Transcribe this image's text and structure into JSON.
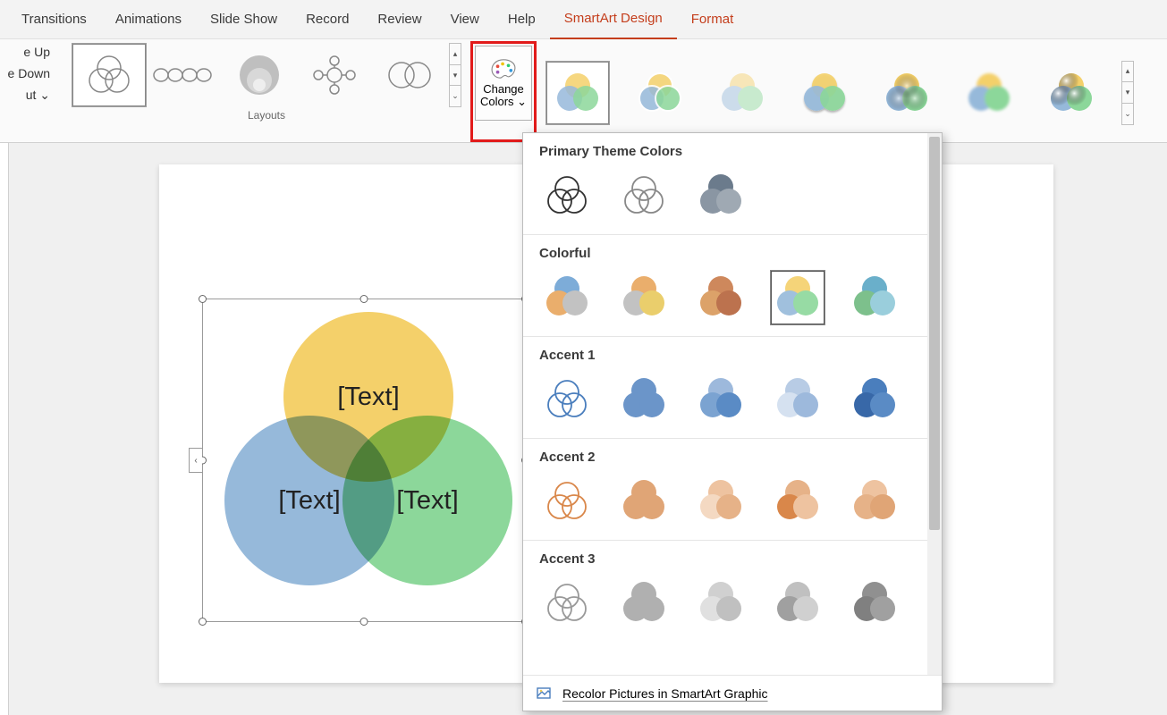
{
  "tabs": {
    "transitions": "Transitions",
    "animations": "Animations",
    "slide_show": "Slide Show",
    "record": "Record",
    "review": "Review",
    "view": "View",
    "help": "Help",
    "smartart_design": "SmartArt Design",
    "format": "Format"
  },
  "truncated_ribbon": {
    "move_up": "e Up",
    "move_down": "e Down",
    "layout": "ut ⌄"
  },
  "layouts_group_label": "Layouts",
  "change_colors_button": {
    "line1": "Change",
    "line2": "Colors ⌄"
  },
  "venn_placeholder": "[Text]",
  "dropdown": {
    "section1": "Primary Theme Colors",
    "section2": "Colorful",
    "section3": "Accent 1",
    "section4": "Accent 2",
    "section5": "Accent 3",
    "footer": "Recolor Pictures in SmartArt Graphic"
  }
}
